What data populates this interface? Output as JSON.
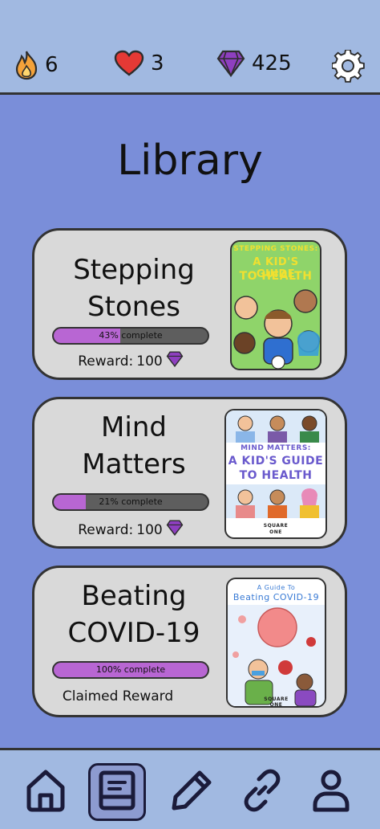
{
  "header": {
    "streak": "6",
    "lives": "3",
    "gems": "425"
  },
  "page": {
    "title": "Library"
  },
  "books": [
    {
      "title_line1": "Stepping",
      "title_line2": "Stones",
      "progress": 0.43,
      "progress_text": "43% complete",
      "reward_label": "Reward:",
      "reward_value": "100",
      "cover_line1": "STEPPING STONES:",
      "cover_line2": "A KID'S GUIDE",
      "cover_line3": "TO HEALTH"
    },
    {
      "title_line1": "Mind",
      "title_line2": "Matters",
      "progress": 0.21,
      "progress_text": "21% complete",
      "reward_label": "Reward:",
      "reward_value": "100",
      "cover_line1": "MIND MATTERS:",
      "cover_line2": "A KID'S GUIDE",
      "cover_line3": "TO HEALTH",
      "cover_brand_line1": "SQUARE",
      "cover_brand_line2": "ONE"
    },
    {
      "title_line1": "Beating",
      "title_line2": "COVID-19",
      "progress": 1.0,
      "progress_text": "100% complete",
      "claimed_text": "Claimed Reward",
      "cover_line1": "A Guide To",
      "cover_line2": "Beating COVID-19",
      "cover_brand_line1": "SQUARE",
      "cover_brand_line2": "ONE"
    }
  ],
  "colors": {
    "background": "#7a8ed9",
    "bar": "#a1b9e1",
    "card": "#d9d9d9",
    "progress_fill": "#b866d3",
    "progress_track": "#5e5e5e",
    "gem": "#8e3fc0",
    "heart": "#e53935",
    "flame": "#f4a23a"
  },
  "nav": [
    {
      "icon": "home-icon"
    },
    {
      "icon": "book-icon",
      "active": true
    },
    {
      "icon": "pencil-icon"
    },
    {
      "icon": "link-icon"
    },
    {
      "icon": "profile-icon"
    }
  ]
}
